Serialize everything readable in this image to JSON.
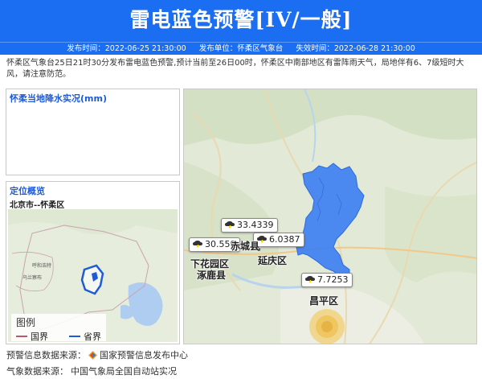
{
  "header": {
    "title": "雷电蓝色预警[IV/一般]",
    "issue_time_label": "发布时间：",
    "issue_time": "2022-06-25 21:30:00",
    "issuer_label": "发布单位：",
    "issuer": "怀柔区气象台",
    "expire_label": "失效时间：",
    "expire_time": "2022-06-28 21:30:00"
  },
  "description": "怀柔区气象台25日21时30分发布雷电蓝色预警,预计当前至26日00时，怀柔区中南部地区有雷阵雨天气，局地伴有6、7级短时大风，请注意防范。",
  "rain_panel": {
    "title": "怀柔当地降水实况(mm)"
  },
  "location_panel": {
    "title": "定位概览",
    "subtitle": "北京市--怀柔区",
    "mini_map_labels": [
      "呼和浩特",
      "乌兰察布"
    ],
    "legend": {
      "title": "图例",
      "items": [
        {
          "label": "国界",
          "color": "#c0566b"
        },
        {
          "label": "省界",
          "color": "#1e5bd8"
        }
      ]
    }
  },
  "map": {
    "warning_area_color": "#3b7df2",
    "markers": [
      {
        "value": "33.4339",
        "icon": "thunderstorm-icon"
      },
      {
        "value": "30.559",
        "icon": "thunderstorm-icon"
      },
      {
        "value": "6.0387",
        "icon": "thunderstorm-icon"
      },
      {
        "value": "7.7253",
        "icon": "thunderstorm-icon"
      }
    ],
    "cities": [
      "赤城县",
      "下花园区",
      "涿鹿县",
      "延庆区",
      "昌平区"
    ]
  },
  "footer": {
    "source_label": "预警信息数据来源：",
    "source_value": "国家预警信息发布中心",
    "weather_label": "气象数据来源：",
    "weather_value": "中国气象局全国自动站实况"
  }
}
